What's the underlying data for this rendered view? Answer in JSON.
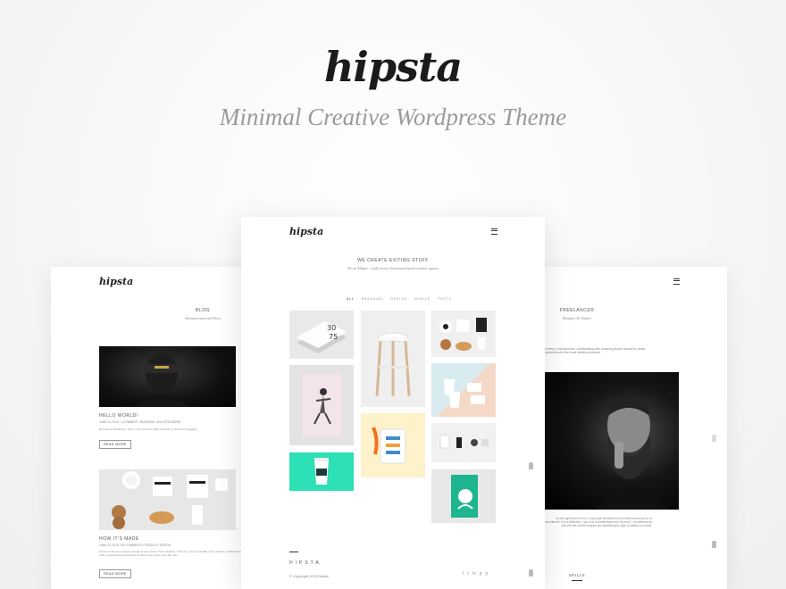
{
  "hero": {
    "logo": "hipsta",
    "tagline": "Minimal Creative Wordpress Theme"
  },
  "left_card": {
    "logo": "hipsta",
    "section_title": "BLOG",
    "section_subtitle": "Announcement and News",
    "posts": [
      {
        "title": "HELLO WORLD!",
        "meta": "JUNE 24, 2015 / 1 COMMENT / BUSINESS, UNCATEGORIZED",
        "excerpt": "Welcome to WordPress. This is your first post. Edit or delete it, then start blogging!",
        "button": "READ MORE"
      },
      {
        "title": "HOW IT'S MADE",
        "meta": "JUNE 24, 2015 / NO COMMENTS / PRODUCT DESIGN",
        "excerpt": "Donec id elit non mi porta gravida at eget metus. Fusce dapibus, tellus ac cursus commodo, tortor mauris condimentum nibh, ut fermentum massa justo sit amet risus. Donec sed odio dui.",
        "button": "READ MORE"
      }
    ]
  },
  "center_card": {
    "logo": "hipsta",
    "headline": "WE CREATE EXITING STUFF",
    "subline": "We are Hipsta - a full-service Indonesian based creative agency",
    "filters": [
      "ALL",
      "BRANDING",
      "DESIGN",
      "MOBILE",
      "PHOTO"
    ],
    "footer_logo": "HIPSTA",
    "copyright": "© Copyright 2015 Hipsta",
    "social": [
      "f",
      "t",
      "in",
      "g",
      "p"
    ]
  },
  "right_card": {
    "section_title": "FREELANCER",
    "section_subtitle": "Designer & Thinker",
    "intro": "I'm living in Banda Aceh, collaborating with amazing people around to create experiences for the most ambitious brands.",
    "body": "Do the right kind of error. It may look effortless but it is hard work and a lot of commitment. It is a fulfillment. I put a lot of commitment into my work. I am affected by the Internet and techniques are advertising to push to satisfy my needs.",
    "skills_label": "SKILLS"
  }
}
